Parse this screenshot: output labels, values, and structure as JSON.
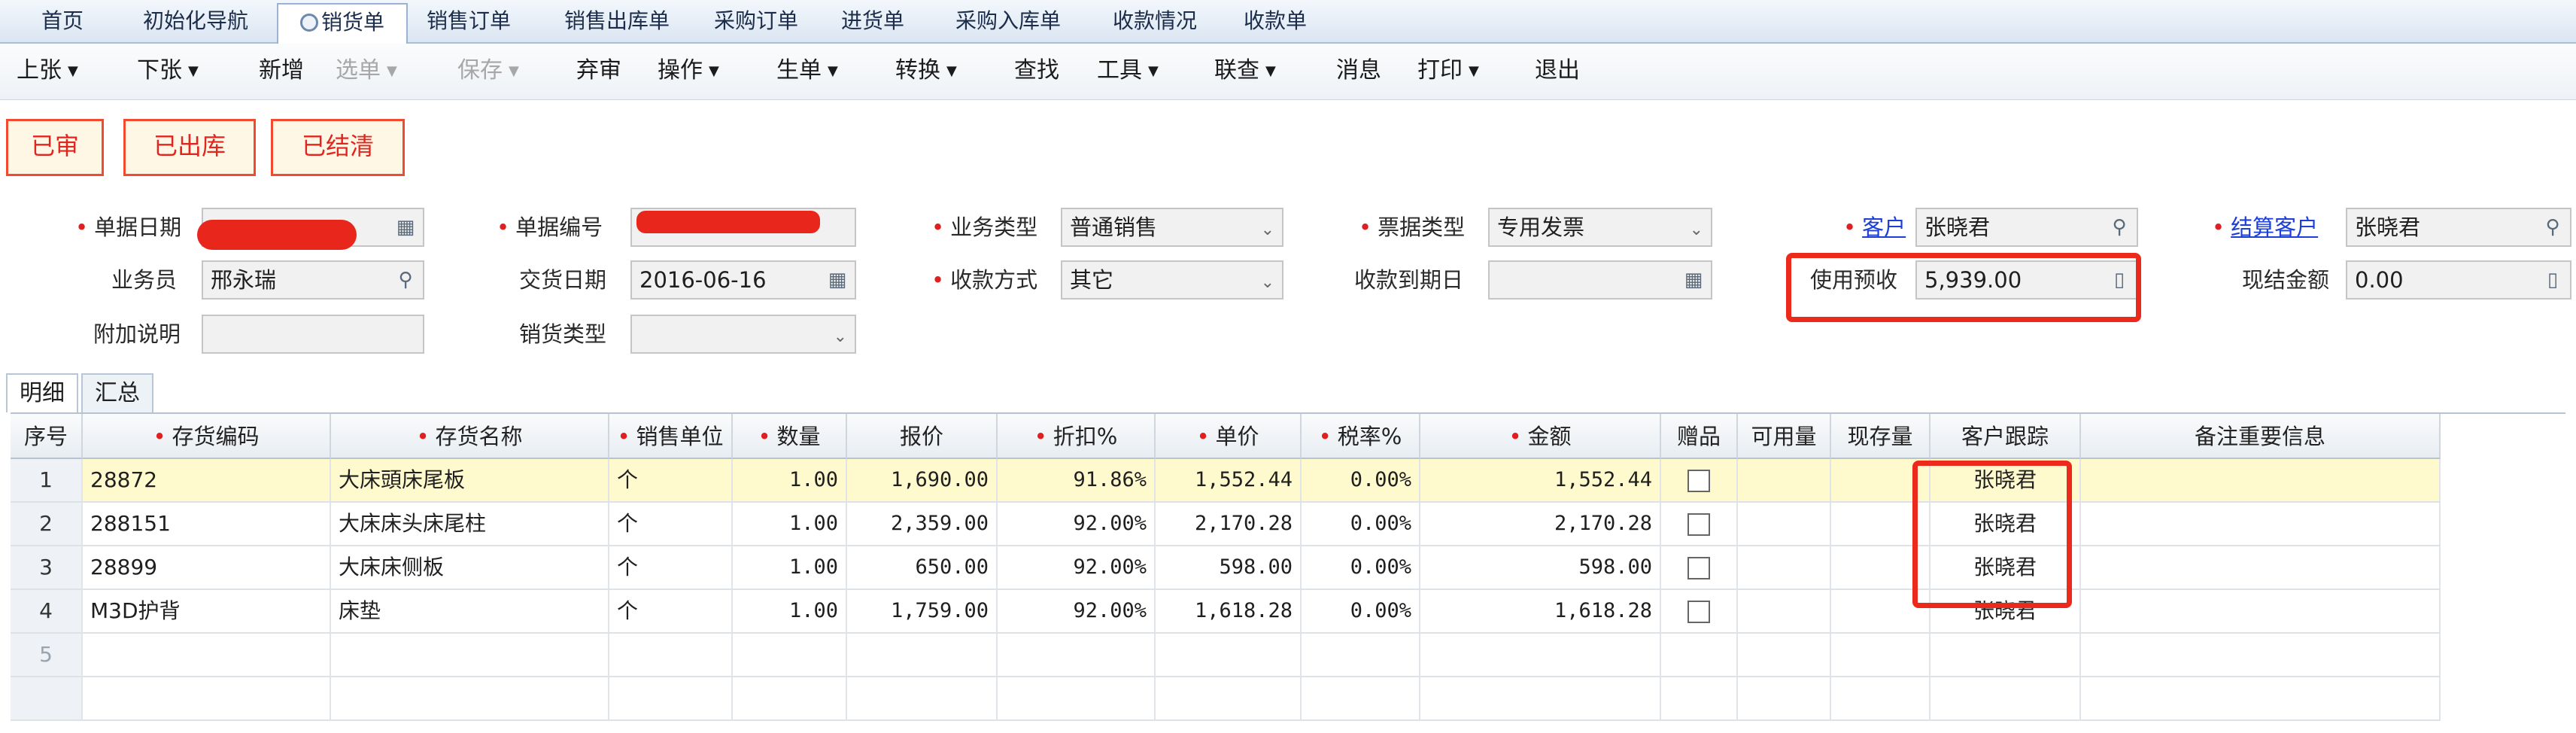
{
  "tabs": [
    "首页",
    "初始化导航",
    "销货单",
    "销售订单",
    "销售出库单",
    "采购订单",
    "进货单",
    "采购入库单",
    "收款情况",
    "收款单"
  ],
  "toolbar": [
    "上张",
    "下张",
    "新增",
    "选单",
    "保存",
    "弃审",
    "操作",
    "生单",
    "转换",
    "查找",
    "工具",
    "联查",
    "消息",
    "打印",
    "退出"
  ],
  "status": [
    "已审",
    "已出库",
    "已结清"
  ],
  "form": {
    "doc_date_label": "单据日期",
    "doc_no_label": "单据编号",
    "biz_type_label": "业务类型",
    "biz_type_value": "普通销售",
    "bill_type_label": "票据类型",
    "bill_type_value": "专用发票",
    "customer_label": "客户",
    "customer_value": "张晓君",
    "settle_customer_label": "结算客户",
    "settle_customer_value": "张晓君",
    "salesman_label": "业务员",
    "salesman_value": "邢永瑞",
    "delivery_date_label": "交货日期",
    "delivery_date_value": "2016-06-16",
    "payment_method_label": "收款方式",
    "payment_method_value": "其它",
    "due_date_label": "收款到期日",
    "due_date_value": "",
    "prepay_label": "使用预收",
    "prepay_value": "5,939.00",
    "cash_amount_label": "现结金额",
    "cash_amount_value": "0.00",
    "remark_label": "附加说明",
    "remark_value": "",
    "sales_type_label": "销货类型",
    "sales_type_value": ""
  },
  "subtabs": [
    "明细",
    "汇总"
  ],
  "columns": [
    "序号",
    "存货编码",
    "存货名称",
    "销售单位",
    "数量",
    "报价",
    "折扣%",
    "单价",
    "税率%",
    "金额",
    "赠品",
    "可用量",
    "现存量",
    "客户跟踪",
    "备注重要信息"
  ],
  "rows": [
    {
      "no": "1",
      "code": "28872",
      "name": "大床頭床尾板",
      "unit": "个",
      "qty": "1.00",
      "quote": "1,690.00",
      "discount": "91.86%",
      "price": "1,552.44",
      "tax": "0.00%",
      "amount": "1,552.44",
      "track": "张晓君"
    },
    {
      "no": "2",
      "code": "288151",
      "name": "大床床头床尾柱",
      "unit": "个",
      "qty": "1.00",
      "quote": "2,359.00",
      "discount": "92.00%",
      "price": "2,170.28",
      "tax": "0.00%",
      "amount": "2,170.28",
      "track": "张晓君"
    },
    {
      "no": "3",
      "code": "28899",
      "name": "大床床侧板",
      "unit": "个",
      "qty": "1.00",
      "quote": "650.00",
      "discount": "92.00%",
      "price": "598.00",
      "tax": "0.00%",
      "amount": "598.00",
      "track": "张晓君"
    },
    {
      "no": "4",
      "code": "M3D护背",
      "name": "床垫",
      "unit": "个",
      "qty": "1.00",
      "quote": "1,759.00",
      "discount": "92.00%",
      "price": "1,618.28",
      "tax": "0.00%",
      "amount": "1,618.28",
      "track": "张晓君"
    },
    {
      "no": "5"
    }
  ],
  "colors": {
    "highlight": "#ec2a1c",
    "link": "#1d3fd6",
    "selected_row": "#fffacd"
  }
}
